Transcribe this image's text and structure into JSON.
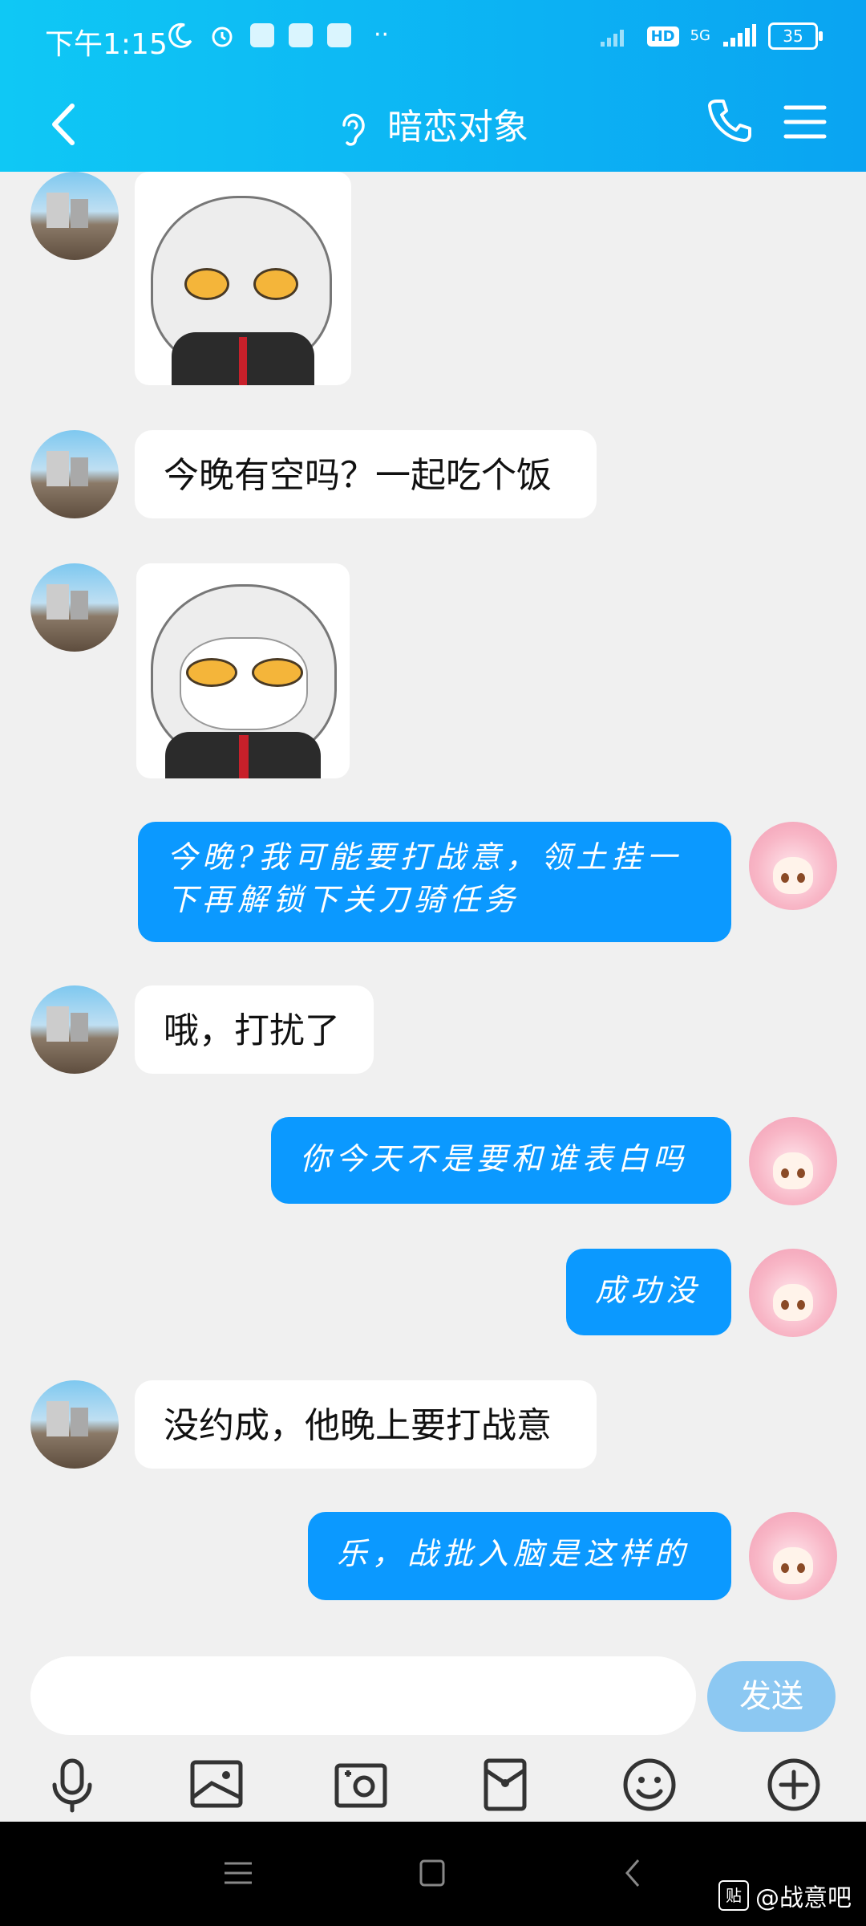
{
  "status_bar": {
    "time": "下午1:15",
    "network": "5G",
    "hd": "HD",
    "battery": "35"
  },
  "header": {
    "title": "暗恋对象",
    "icons": [
      "back-arrow-icon",
      "ear-icon",
      "phone-icon",
      "menu-icon"
    ]
  },
  "messages": [
    {
      "side": "left",
      "type": "sticker",
      "sticker": "grumpy-white-hair-anime-girl"
    },
    {
      "side": "left",
      "type": "text",
      "text": "今晚有空吗？一起吃个饭"
    },
    {
      "side": "left",
      "type": "sticker",
      "sticker": "smug-white-hair-anime-girl"
    },
    {
      "side": "right",
      "type": "text",
      "text": "今晚?我可能要打战意，领土挂一下再解锁下关刀骑任务"
    },
    {
      "side": "left",
      "type": "text",
      "text": "哦，打扰了"
    },
    {
      "side": "right",
      "type": "text",
      "text": "你今天不是要和谁表白吗"
    },
    {
      "side": "right",
      "type": "text",
      "text": "成功没"
    },
    {
      "side": "left",
      "type": "text",
      "text": "没约成，他晚上要打战意"
    },
    {
      "side": "right",
      "type": "text",
      "text": "乐，战批入脑是这样的"
    }
  ],
  "input": {
    "placeholder": "",
    "send_label": "发送"
  },
  "toolbar": {
    "icons": [
      "microphone-icon",
      "image-icon",
      "camera-icon",
      "red-packet-icon",
      "emoji-icon",
      "plus-icon"
    ]
  },
  "watermark": {
    "badge": "贴",
    "text": "@战意吧"
  },
  "colors": {
    "header_start": "#0fc8f5",
    "header_end": "#0aa4f2",
    "right_bubble": "#0b99ff",
    "send_button": "#8cc8f2",
    "chat_bg": "#f0f0f0"
  }
}
